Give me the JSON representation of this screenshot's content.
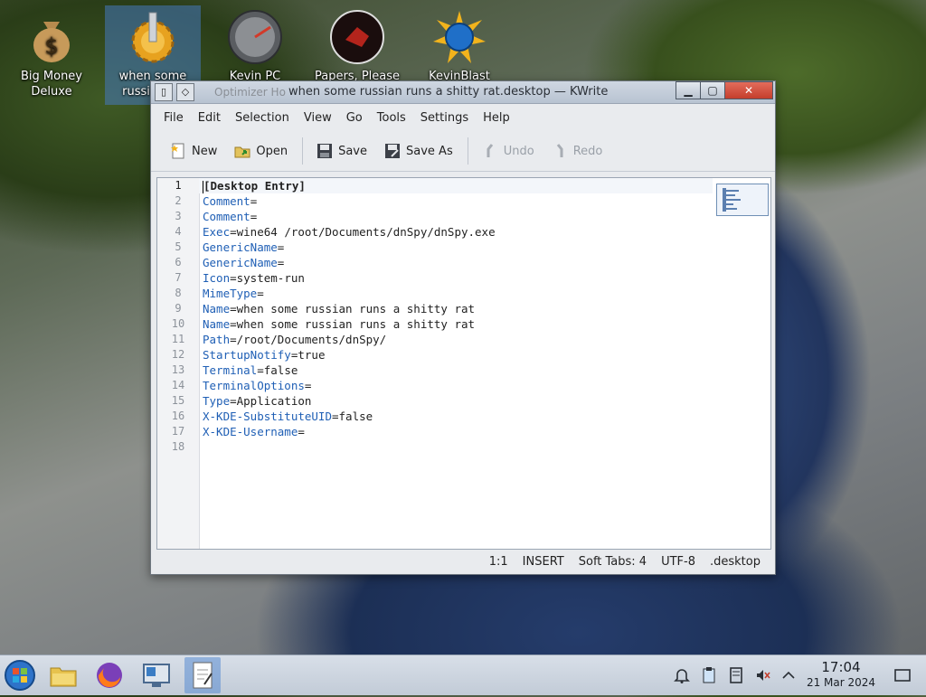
{
  "desktop": {
    "icons": [
      {
        "label": "Big Money Deluxe"
      },
      {
        "label": "when some russian r..."
      },
      {
        "label": "Kevin PC"
      },
      {
        "label": "Papers, Please"
      },
      {
        "label": "KevinBlast"
      }
    ]
  },
  "window": {
    "title": "when some russian runs a shitty rat.desktop — KWrite",
    "ghost_title": "Optimizer Ho",
    "menu": [
      "File",
      "Edit",
      "Selection",
      "View",
      "Go",
      "Tools",
      "Settings",
      "Help"
    ],
    "toolbar": {
      "new": "New",
      "open": "Open",
      "save": "Save",
      "save_as": "Save As",
      "undo": "Undo",
      "redo": "Redo"
    },
    "lines": [
      {
        "n": "1",
        "key": "[Desktop Entry]",
        "val": ""
      },
      {
        "n": "2",
        "key": "Comment",
        "val": "="
      },
      {
        "n": "3",
        "key": "Comment",
        "val": "="
      },
      {
        "n": "4",
        "key": "Exec",
        "val": "=wine64 /root/Documents/dnSpy/dnSpy.exe"
      },
      {
        "n": "5",
        "key": "GenericName",
        "val": "="
      },
      {
        "n": "6",
        "key": "GenericName",
        "val": "="
      },
      {
        "n": "7",
        "key": "Icon",
        "val": "=system-run"
      },
      {
        "n": "8",
        "key": "MimeType",
        "val": "="
      },
      {
        "n": "9",
        "key": "Name",
        "val": "=when some russian runs a shitty rat"
      },
      {
        "n": "10",
        "key": "Name",
        "val": "=when some russian runs a shitty rat"
      },
      {
        "n": "11",
        "key": "Path",
        "val": "=/root/Documents/dnSpy/"
      },
      {
        "n": "12",
        "key": "StartupNotify",
        "val": "=true"
      },
      {
        "n": "13",
        "key": "Terminal",
        "val": "=false"
      },
      {
        "n": "14",
        "key": "TerminalOptions",
        "val": "="
      },
      {
        "n": "15",
        "key": "Type",
        "val": "=Application"
      },
      {
        "n": "16",
        "key": "X-KDE-SubstituteUID",
        "val": "=false"
      },
      {
        "n": "17",
        "key": "X-KDE-Username",
        "val": "="
      },
      {
        "n": "18",
        "key": "",
        "val": ""
      }
    ],
    "status": {
      "position": "1:1",
      "mode": "INSERT",
      "tabs": "Soft Tabs: 4",
      "encoding": "UTF-8",
      "filetype": ".desktop"
    }
  },
  "taskbar": {
    "time": "17:04",
    "date": "21 Mar 2024"
  },
  "colors": {
    "key": "#1f5fb5",
    "close": "#c43e2c",
    "selection": "#4678be"
  }
}
